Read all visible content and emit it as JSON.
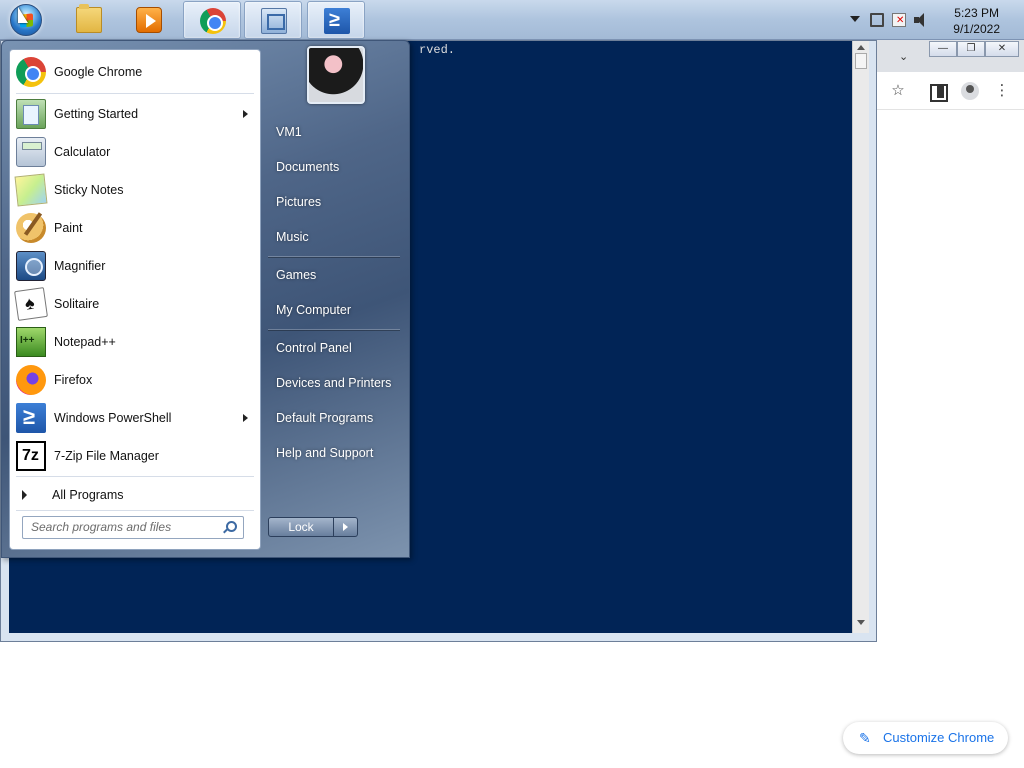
{
  "taskbar": {
    "pinned": [
      {
        "name": "Windows Explorer",
        "icon": "folder-icon"
      },
      {
        "name": "Windows Media Player",
        "icon": "media-player-icon"
      },
      {
        "name": "Google Chrome",
        "icon": "chrome-icon"
      },
      {
        "name": "Control Panel",
        "icon": "control-panel-icon"
      },
      {
        "name": "Windows PowerShell",
        "icon": "powershell-icon"
      }
    ],
    "clock": {
      "time": "5:23 PM",
      "date": "9/1/2022"
    }
  },
  "console": {
    "visible_text": "rved."
  },
  "chrome": {
    "tab_search_glyph": "⌄",
    "window_controls": [
      "—",
      "❐",
      "✕"
    ],
    "customize_label": "Customize Chrome"
  },
  "start_menu": {
    "programs": [
      {
        "label": "Google Chrome",
        "icon": "chrome-icon",
        "has_submenu": false
      },
      {
        "label": "Getting Started",
        "icon": "getting-started-icon",
        "has_submenu": true
      },
      {
        "label": "Calculator",
        "icon": "calculator-icon",
        "has_submenu": false
      },
      {
        "label": "Sticky Notes",
        "icon": "sticky-notes-icon",
        "has_submenu": false
      },
      {
        "label": "Paint",
        "icon": "paint-icon",
        "has_submenu": false
      },
      {
        "label": "Magnifier",
        "icon": "magnifier-icon",
        "has_submenu": false
      },
      {
        "label": "Solitaire",
        "icon": "solitaire-icon",
        "has_submenu": false
      },
      {
        "label": "Notepad++",
        "icon": "notepadpp-icon",
        "has_submenu": false
      },
      {
        "label": "Firefox",
        "icon": "firefox-icon",
        "has_submenu": false
      },
      {
        "label": "Windows PowerShell",
        "icon": "powershell-icon",
        "has_submenu": true
      },
      {
        "label": "7-Zip File Manager",
        "icon": "seven-zip-icon",
        "has_submenu": false
      }
    ],
    "all_programs": "All Programs",
    "search_placeholder": "Search programs and files",
    "right_items": [
      "VM1",
      "Documents",
      "Pictures",
      "Music",
      "Games",
      "My Computer",
      "Control Panel",
      "Devices and Printers",
      "Default Programs",
      "Help and Support"
    ],
    "lock_label": "Lock"
  }
}
